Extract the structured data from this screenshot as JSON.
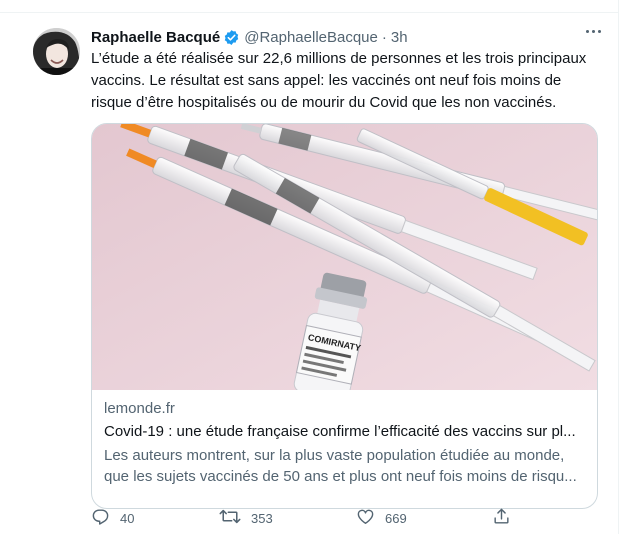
{
  "tweet": {
    "author_name": "Raphaelle Bacqué",
    "handle": "@RaphaelleBacque",
    "separator": "·",
    "time": "3h",
    "text": "L’étude a été réalisée sur 22,6 millions de personnes et les trois principaux vaccins. Le résultat est sans appel: les vaccinés ont neuf fois moins de risque d’être hospitalisés ou de mourir du Covid que les non vaccinés.",
    "card": {
      "domain": "lemonde.fr",
      "title": "Covid-19 : une étude française confirme l’efficacité des vaccins sur pl...",
      "description": "Les auteurs montrent, sur la plus vaste population étudiée au monde, que les sujets vaccinés de 50 ans et plus ont neuf fois moins de risqu...",
      "image_label": "COMIRNATY"
    },
    "actions": {
      "replies": "40",
      "retweets": "353",
      "likes": "669"
    }
  },
  "colors": {
    "text": "#0f1419",
    "secondary": "#536471",
    "verified": "#1d9bf0",
    "border": "#cfd9de"
  },
  "icons": [
    "verified-badge-icon",
    "more-icon",
    "reply-icon",
    "retweet-icon",
    "like-icon",
    "share-icon"
  ]
}
